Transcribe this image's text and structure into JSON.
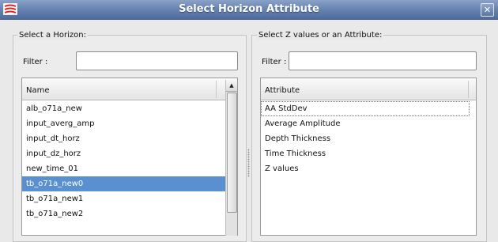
{
  "window": {
    "title": "Select Horizon Attribute"
  },
  "icons": {
    "app": "app-menu-icon",
    "close": "close-icon"
  },
  "left": {
    "group_label": "Select a Horizon:",
    "filter_label": "Filter :",
    "filter_value": "",
    "column": "Name",
    "items": [
      {
        "label": "alb_o71a_new"
      },
      {
        "label": "input_averg_amp"
      },
      {
        "label": "input_dt_horz"
      },
      {
        "label": "input_dz_horz"
      },
      {
        "label": "new_time_01"
      },
      {
        "label": "tb_o71a_new0"
      },
      {
        "label": "tb_o71a_new1"
      },
      {
        "label": "tb_o71a_new2"
      }
    ],
    "selected_index": 5
  },
  "right": {
    "group_label": "Select Z values or an Attribute:",
    "filter_label": "Filter :",
    "filter_value": "",
    "column": "Attribute",
    "items": [
      {
        "label": "AA StdDev"
      },
      {
        "label": "Average Amplitude"
      },
      {
        "label": "Depth Thickness"
      },
      {
        "label": "Time Thickness"
      },
      {
        "label": "Z values"
      }
    ],
    "current_index": 0
  },
  "colors": {
    "selection": "#5a8fd0",
    "titlebar": "#6a85b3"
  }
}
